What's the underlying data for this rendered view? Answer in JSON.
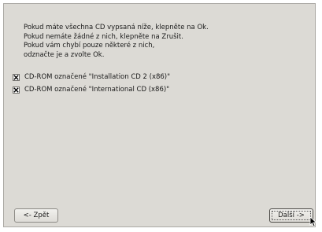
{
  "instructions": [
    "Pokud máte všechna CD vypsaná níže, klepněte na Ok.",
    "Pokud nemáte žádné z nich, klepněte na Zrušit.",
    "Pokud vám chybí pouze některé z nich,",
    "odznačte je a zvolte Ok."
  ],
  "cd_items": [
    {
      "label": "CD-ROM označené \"Installation CD 2 (x86)\"",
      "checked": true
    },
    {
      "label": "CD-ROM označené \"International CD (x86)\"",
      "checked": true
    }
  ],
  "buttons": {
    "back_label": "<- Zpět",
    "next_label": "Další ->"
  },
  "icons": {
    "checkbox_check": "x-check-icon",
    "cursor": "mouse-pointer-icon"
  },
  "colors": {
    "panel_bg": "#dcdad5",
    "outer_bg": "#ffffff"
  }
}
